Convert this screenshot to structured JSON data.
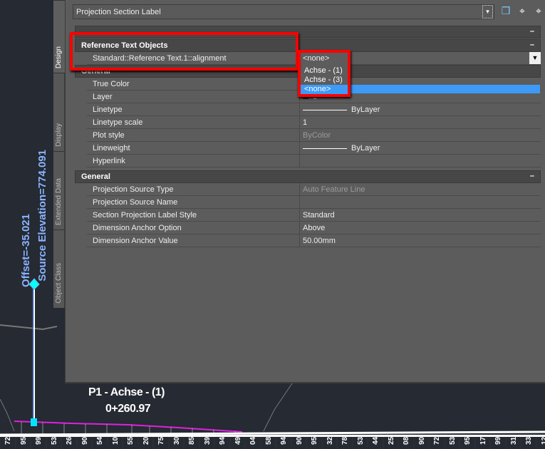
{
  "tabs": [
    "Design",
    "Display",
    "Extended Data",
    "Object Class"
  ],
  "object_type": "Projection Section Label",
  "toolbar_icons": [
    "add-selection-icon",
    "pick-object-icon",
    "quick-select-icon"
  ],
  "sections": {
    "blank_header": "",
    "reference": {
      "title": "Reference Text Objects",
      "row_label": "Standard::Reference Text.1::alignment",
      "row_value": "<none>"
    },
    "general1": {
      "title": "General",
      "rows": [
        {
          "k": "True Color",
          "v": ""
        },
        {
          "k": "Layer",
          "v": "0"
        },
        {
          "k": "Linetype",
          "v": "ByLayer"
        },
        {
          "k": "Linetype scale",
          "v": "1"
        },
        {
          "k": "Plot style",
          "v": "ByColor"
        },
        {
          "k": "Lineweight",
          "v": "ByLayer"
        },
        {
          "k": "Hyperlink",
          "v": ""
        }
      ]
    },
    "general2": {
      "title": "General",
      "rows": [
        {
          "k": "Projection Source Type",
          "v": "Auto Feature Line"
        },
        {
          "k": "Projection Source Name",
          "v": ""
        },
        {
          "k": "Section Projection Label Style",
          "v": "Standard"
        },
        {
          "k": "Dimension Anchor Option",
          "v": "Above"
        },
        {
          "k": "Dimension Anchor Value",
          "v": "50.00mm"
        }
      ]
    }
  },
  "dropdown_options": [
    "Achse - (1)",
    "Achse - (3)",
    "<none>"
  ],
  "collapse_symbol": "–",
  "cad": {
    "offset": "Offset=-35.021",
    "elevation": "Source Elevation=774.091",
    "label": "P1 - Achse - (1)",
    "station": "0+260.97",
    "ticks": [
      "72",
      "95",
      "99",
      "53",
      "26",
      "90",
      "54",
      "10",
      "55",
      "20",
      "75",
      "30",
      "85",
      "39",
      "94",
      "49",
      "04",
      "58",
      "94",
      "90",
      "95",
      "32",
      "78",
      "53",
      "44",
      "25",
      "08",
      "90",
      "72",
      "53",
      "95",
      "17",
      "99",
      "31",
      "33",
      "12"
    ]
  },
  "colors": {
    "highlight": "#3d9bf7",
    "annotation": "#f00",
    "cad_bg": "#252a33",
    "profile": "#e020e0"
  }
}
